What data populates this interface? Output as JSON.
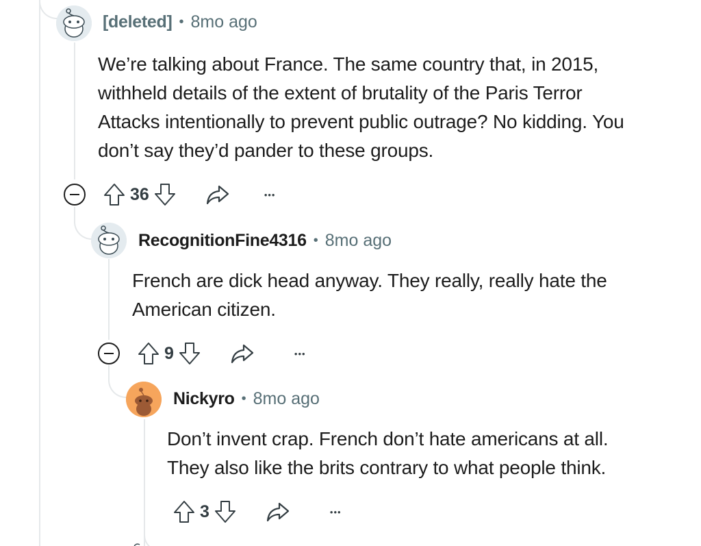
{
  "comments": [
    {
      "username": "[deleted]",
      "separator": "•",
      "time": "8mo ago",
      "body": [
        "We’re talking about France. The same country that, in 2015,",
        "withheld details of the extent of brutality of the Paris Terror",
        "Attacks intentionally to prevent public outrage? No kidding. You",
        "don’t say they’d pander to these groups."
      ],
      "votes": "36",
      "avatar_icon": "snoo-deleted-avatar-icon"
    },
    {
      "username": "RecognitionFine4316",
      "separator": "•",
      "time": "8mo ago",
      "body": [
        "French are dick head anyway. They really, really hate the",
        "American citizen."
      ],
      "votes": "9",
      "avatar_icon": "snoo-default-avatar-icon"
    },
    {
      "username": "Nickyro",
      "separator": "•",
      "time": "8mo ago",
      "body": [
        "Don’t invent crap. French don’t hate americans at all.",
        "They also like the brits contrary to what people think."
      ],
      "votes": "3",
      "avatar_icon": "snoo-orange-avatar-icon"
    }
  ],
  "more_label": "•••",
  "colors": {
    "meta": "#576f76",
    "thread": "#e5e8ea",
    "avatar_orange": "#f6a55c"
  }
}
